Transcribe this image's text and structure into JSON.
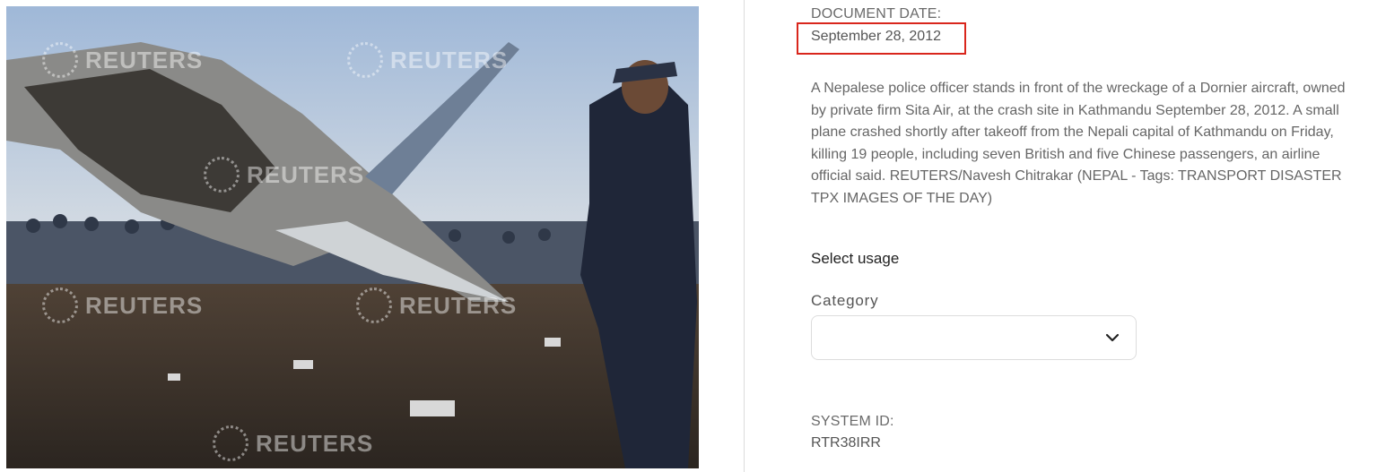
{
  "photo": {
    "watermark_text": "REUTERS"
  },
  "document_date": {
    "label": "DOCUMENT DATE:",
    "value": "September 28, 2012"
  },
  "caption": "A Nepalese police officer stands in front of the wreckage of a Dornier aircraft, owned by private firm Sita Air, at the crash site in Kathmandu September 28, 2012. A small plane crashed shortly after takeoff from the Nepali capital of Kathmandu on Friday, killing 19 people, including seven British and five Chinese passengers, an airline official said. REUTERS/Navesh Chitrakar (NEPAL - Tags: TRANSPORT DISASTER TPX IMAGES OF THE DAY)",
  "usage": {
    "heading": "Select usage",
    "category_label": "Category",
    "category_value": "",
    "dropdown_icon": "chevron-down-icon"
  },
  "system_id": {
    "label": "SYSTEM ID:",
    "value": "RTR38IRR"
  },
  "colors": {
    "highlight_box": "#d9261c",
    "divider": "#dcdcdc"
  }
}
